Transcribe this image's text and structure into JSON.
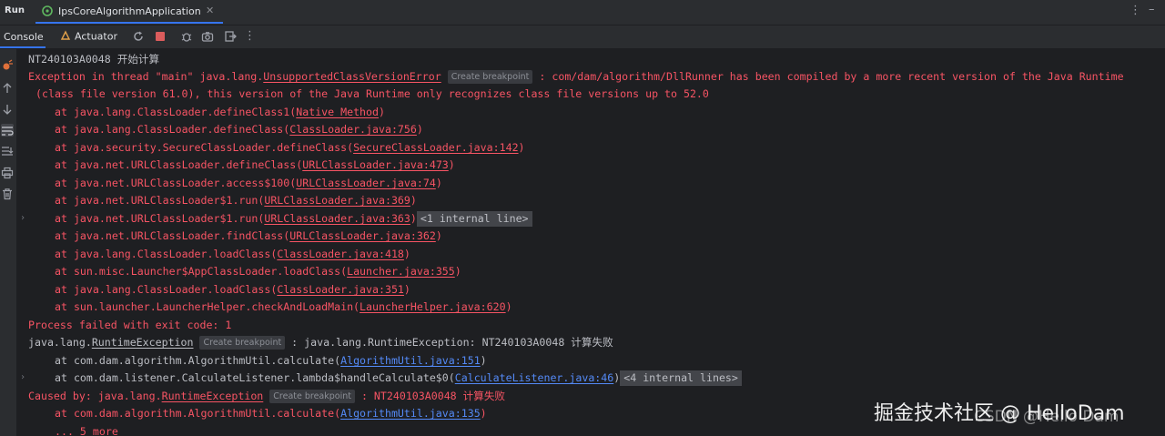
{
  "topbar": {
    "run_label": "Run",
    "tab_title": "IpsCoreAlgorithmApplication",
    "tab_close": "✕"
  },
  "toolbar": {
    "console_label": "Console",
    "actuator_label": "Actuator"
  },
  "console": {
    "line0": "NT240103A0048 开始计算",
    "exc1_a": "Exception in thread \"main\" java.lang.",
    "exc1_link": "UnsupportedClassVersionError",
    "exc1_b": " : com/dam/algorithm/DllRunner has been compiled by a more recent version of the Java Runtime",
    "exc1_cont": "(class file version 61.0), this version of the Java Runtime only recognizes class file versions up to 52.0",
    "create_breakpoint": "Create breakpoint",
    "stack1": [
      {
        "text": "at java.lang.ClassLoader.defineClass1(",
        "link": "Native Method",
        "end": ")"
      },
      {
        "text": "at java.lang.ClassLoader.defineClass(",
        "link": "ClassLoader.java:756",
        "end": ")"
      },
      {
        "text": "at java.security.SecureClassLoader.defineClass(",
        "link": "SecureClassLoader.java:142",
        "end": ")"
      },
      {
        "text": "at java.net.URLClassLoader.defineClass(",
        "link": "URLClassLoader.java:473",
        "end": ")"
      },
      {
        "text": "at java.net.URLClassLoader.access$100(",
        "link": "URLClassLoader.java:74",
        "end": ")"
      },
      {
        "text": "at java.net.URLClassLoader$1.run(",
        "link": "URLClassLoader.java:369",
        "end": ")"
      },
      {
        "text": "at java.net.URLClassLoader$1.run(",
        "link": "URLClassLoader.java:363",
        "end": ")"
      },
      {
        "text": "at java.net.URLClassLoader.findClass(",
        "link": "URLClassLoader.java:362",
        "end": ")"
      },
      {
        "text": "at java.lang.ClassLoader.loadClass(",
        "link": "ClassLoader.java:418",
        "end": ")"
      },
      {
        "text": "at sun.misc.Launcher$AppClassLoader.loadClass(",
        "link": "Launcher.java:355",
        "end": ")"
      },
      {
        "text": "at java.lang.ClassLoader.loadClass(",
        "link": "ClassLoader.java:351",
        "end": ")"
      },
      {
        "text": "at sun.launcher.LauncherHelper.checkAndLoadMain(",
        "link": "LauncherHelper.java:620",
        "end": ")"
      }
    ],
    "fold1": "<1 internal line>",
    "process_failed": "Process failed with exit code: 1",
    "rt_prefix": "java.lang.",
    "rt_link": "RuntimeException",
    "rt_suffix": " : java.lang.RuntimeException: NT240103A0048 计算失败",
    "rt_at1_text": "at com.dam.algorithm.AlgorithmUtil.calculate(",
    "rt_at1_link": "AlgorithmUtil.java:151",
    "rt_at2_text": "at com.dam.listener.CalculateListener.lambda$handleCalculate$0(",
    "rt_at2_link": "CalculateListener.java:46",
    "fold2": "<4 internal lines>",
    "caused_prefix": "Caused by: java.lang.",
    "caused_link": "RuntimeException",
    "caused_suffix": " : NT240103A0048 计算失败",
    "cb_at_text": "at com.dam.algorithm.AlgorithmUtil.calculate(",
    "cb_at_link": "AlgorithmUtil.java:135",
    "more": "... 5 more",
    "close_paren": ")"
  },
  "watermark": "掘金技术社区 @ HelloDam",
  "watermark_ghost": "CSDN @Hello Dam",
  "colors": {
    "error_red": "#f75464",
    "link_blue": "#548af7",
    "accent_blue": "#3574f0",
    "console_bg": "#1e1f22"
  }
}
